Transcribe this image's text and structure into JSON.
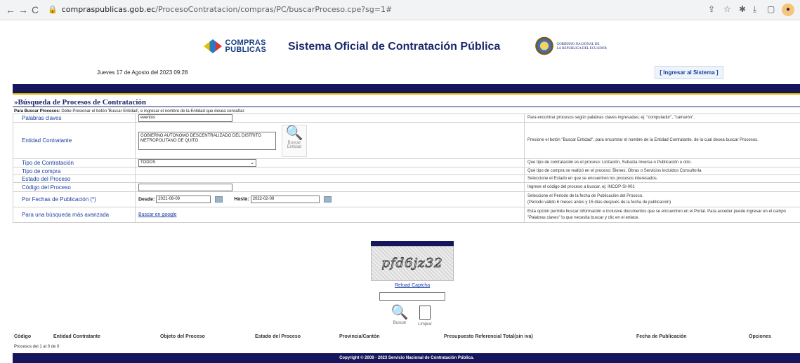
{
  "browser": {
    "url_domain": "compraspublicas.gob.ec",
    "url_path": "/ProcesoContratacion/compras/PC/buscarProceso.cpe?sg=1#"
  },
  "header": {
    "logo_text_line1": "COMPRAS",
    "logo_text_line2": "PUBLICAS",
    "site_title": "Sistema Oficial de Contratación Pública",
    "gov_line1": "GOBIERNO NACIONAL DE",
    "gov_line2": "LA REPUBLICA DEL ECUADOR",
    "date": "Jueves 17 de Agosto del 2023 09:28",
    "login_label": "[ Ingresar al Sistema ]"
  },
  "search": {
    "title": "»Búsqueda de Procesos de Contratación",
    "instructions_bold": "Para Buscar Procesos:",
    "instructions": " Debe Presionar el botón 'Buscar Entidad', e ingresar el nombre de la Entidad que desea consultar.",
    "rows": {
      "keywords_label": "Palabras claves",
      "keywords_value": "eventos",
      "keywords_help": "Para encontrar procesos según palabras claves ingresadas; ej: \"computador\", \"camarón\".",
      "entity_label": "Entidad Contratante",
      "entity_value": "GOBIERNO AUTONOMO DESCENTRALIZADO DEL DISTRITO METROPOLITANO DE QUITO",
      "entity_button": "Buscar Entidad",
      "entity_help": "Presione el botón \"Buscar Entidad\", para encontrar el nombre de la Entidad Contratante, de la cual desea buscar Procesos.",
      "type_label": "Tipo de Contratación",
      "type_value": "TODOS",
      "type_help": "Que tipo de contratación es el proceso: Licitación, Subasta Inversa o Publicación u otro.",
      "purchase_label": "Tipo de compra",
      "purchase_help": "Qué tipo de compra se realizó en el proceso: Bienes, Obras o Servicios incluidos Consultoría",
      "status_label": "Estado del Proceso",
      "status_help": "Seleccione el Estado en que se encuentren los procesos interesados.",
      "code_label": "Código del Proceso",
      "code_value": "",
      "code_help": "Ingrese el código del proceso a buscar, ej: INCOP-SI-001",
      "dates_label": "Por Fechas de Publicación (*)",
      "from_label": "Desde:",
      "from_value": "2021-08-09",
      "to_label": "Hasta:",
      "to_value": "2022-02-09",
      "dates_help_1": "Seleccione el Periodo de la fecha de Publicación del Proceso.",
      "dates_help_2": "(Periodo válido 6 meses antes y 15 días después de la fecha de publicación)",
      "advanced_label": "Para una búsqueda más avanzada",
      "advanced_link": "Buscar en google",
      "advanced_help": "Esta opción permite buscar información e inclusive documentos que se encuentren en el Portal. Para acceder puede ingresar en el campo \"Palabras claves\" lo que necesita buscar y clic en el enlace."
    },
    "captcha_text": "pfd6jz32",
    "reload_label": "Reload Captcha",
    "search_button": "Buscar",
    "clear_button": "Limpiar"
  },
  "results": {
    "columns": [
      "Código",
      "Entidad Contratante",
      "Objeto del Proceso",
      "Estado del Proceso",
      "Provincia/Cantón",
      "Presupuesto Referencial Total(sin iva)",
      "Fecha de Publicación",
      "Opciones"
    ],
    "count_text": "Procesos del 1 al 0 de 0"
  },
  "footer": {
    "copyright": "Copyright © 2008 - 2023 Servicio Nacional de Contratación Pública."
  }
}
